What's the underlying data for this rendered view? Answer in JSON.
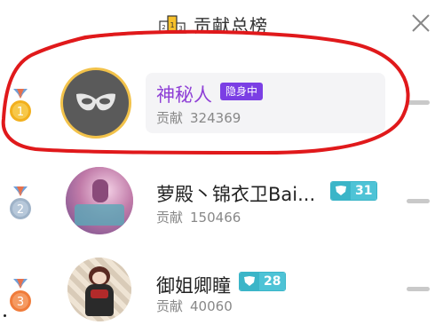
{
  "header": {
    "title": "贡献总榜",
    "close_icon": "close-icon",
    "podium_icon": "podium-icon"
  },
  "ranking": [
    {
      "rank": "1",
      "name": "神秘人",
      "badge": "隐身中",
      "contrib_label": "贡献",
      "contrib_value": "324369",
      "medal_color": "#f2b01e"
    },
    {
      "rank": "2",
      "name": "萝殿丶锦衣卫Bai...",
      "level": "31",
      "contrib_label": "贡献",
      "contrib_value": "150466",
      "medal_color": "#9fb3c8"
    },
    {
      "rank": "3",
      "name": "御姐卿瞳",
      "level": "28",
      "contrib_label": "贡献",
      "contrib_value": "40060",
      "medal_color": "#f07c3b"
    }
  ],
  "colors": {
    "hidden_badge": "#7b3fe4",
    "level_badge": "#3bb5c8",
    "annotation": "#e0191b",
    "name_highlight": "#8e3fd6"
  }
}
